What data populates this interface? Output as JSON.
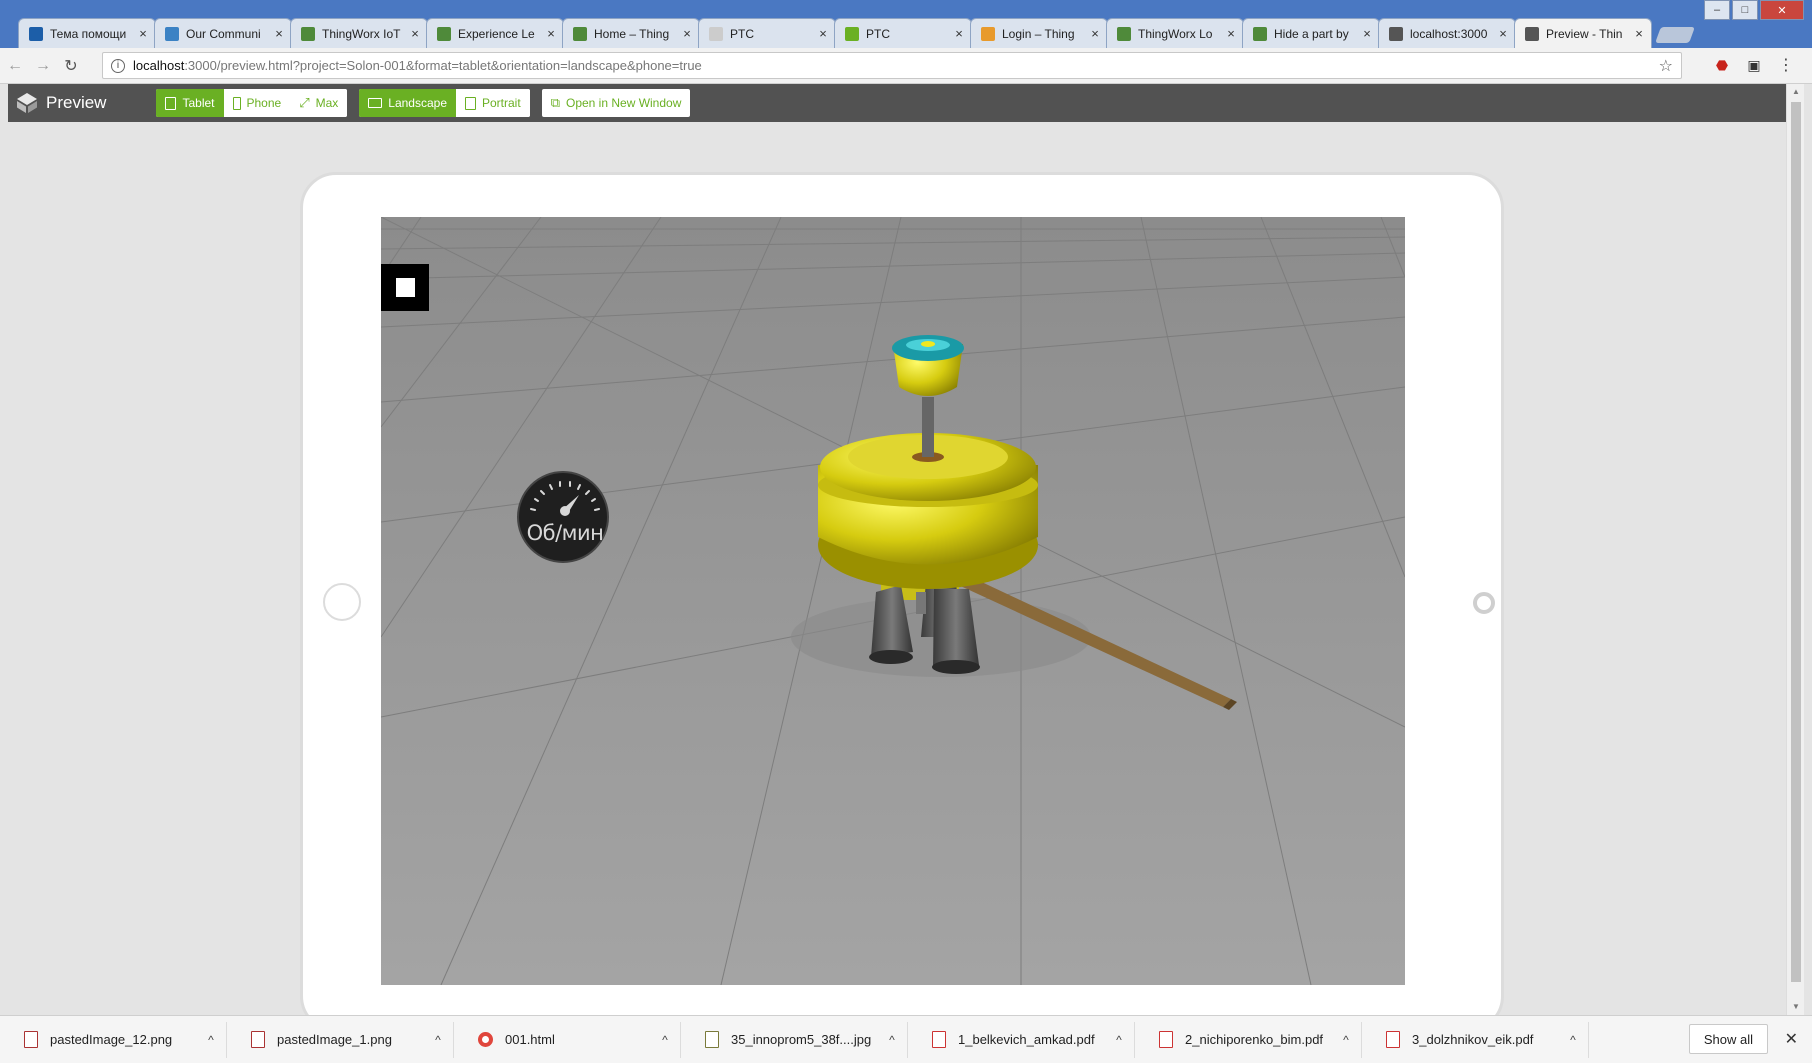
{
  "browser": {
    "tabs": [
      {
        "title": "Тема помощи",
        "favicon_color": "#1c5ea8"
      },
      {
        "title": "Our Communi",
        "favicon_color": "#3b82c4"
      },
      {
        "title": "ThingWorx IoT",
        "favicon_color": "#4f8a3a"
      },
      {
        "title": "Experience Le",
        "favicon_color": "#4f8a3a"
      },
      {
        "title": "Home – Thing",
        "favicon_color": "#4f8a3a"
      },
      {
        "title": "PTC",
        "favicon_color": "#cccccc"
      },
      {
        "title": "PTC",
        "favicon_color": "#6ab023"
      },
      {
        "title": "Login – Thing",
        "favicon_color": "#e89a2c"
      },
      {
        "title": "ThingWorx Lo",
        "favicon_color": "#4f8a3a"
      },
      {
        "title": "Hide a part by",
        "favicon_color": "#4f8a3a"
      },
      {
        "title": "localhost:3000",
        "favicon_color": "#555555"
      },
      {
        "title": "Preview - Thin",
        "favicon_color": "#555555",
        "active": true
      }
    ],
    "window_controls": {
      "minimize": "–",
      "maximize": "□",
      "close": "✕"
    },
    "url_host": "localhost",
    "url_rest": ":3000/preview.html?project=Solon-001&format=tablet&orientation=landscape&phone=true"
  },
  "preview_header": {
    "title": "Preview",
    "device_buttons": {
      "tablet": "Tablet",
      "phone": "Phone",
      "max": "Max"
    },
    "orientation_buttons": {
      "landscape": "Landscape",
      "portrait": "Portrait"
    },
    "open_new_window": "Open in New Window",
    "accent_color": "#6ab023"
  },
  "viewport": {
    "gauge_label": "Об/мин"
  },
  "downloads": {
    "items": [
      {
        "name": "pastedImage_12.png",
        "kind": "img"
      },
      {
        "name": "pastedImage_1.png",
        "kind": "img"
      },
      {
        "name": "001.html",
        "kind": "chrome"
      },
      {
        "name": "35_innoprom5_38f....jpg",
        "kind": "jpg"
      },
      {
        "name": "1_belkevich_amkad.pdf",
        "kind": "pdf"
      },
      {
        "name": "2_nichiporenko_bim.pdf",
        "kind": "pdf"
      },
      {
        "name": "3_dolzhnikov_eik.pdf",
        "kind": "pdf"
      }
    ],
    "show_all": "Show all"
  }
}
